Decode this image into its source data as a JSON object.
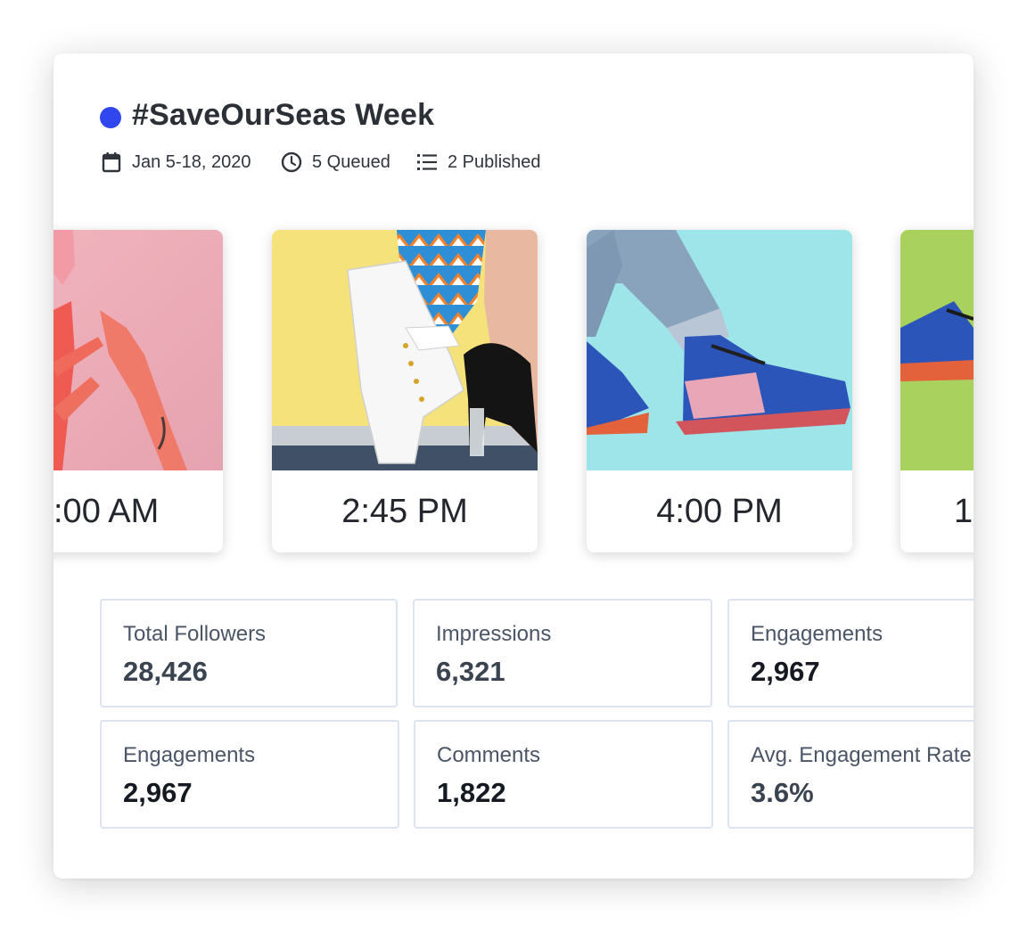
{
  "campaign": {
    "dot_color": "#3047f0",
    "title": "#SaveOurSeas Week",
    "meta": {
      "date_range": "Jan 5-18, 2020",
      "queued": "5 Queued",
      "published": "2 Published"
    }
  },
  "posts": [
    {
      "time": ":00 AM",
      "image": "hands tying pink sneaker laces"
    },
    {
      "time": "2:45 PM",
      "image": "white sneaker and black heel with patterned sock"
    },
    {
      "time": "4:00 PM",
      "image": "blue and pink sneakers on teal background"
    },
    {
      "time": "1",
      "image": "blue sneaker on green background"
    }
  ],
  "stats": [
    {
      "label": "Total Followers",
      "value": "28,426"
    },
    {
      "label": "Impressions",
      "value": "6,321"
    },
    {
      "label": "Engagements",
      "value": "2,967"
    },
    {
      "label": "Engagements",
      "value": "2,967"
    },
    {
      "label": "Comments",
      "value": "1,822"
    },
    {
      "label": "Avg. Engagement Rate",
      "value": "3.6%"
    }
  ]
}
